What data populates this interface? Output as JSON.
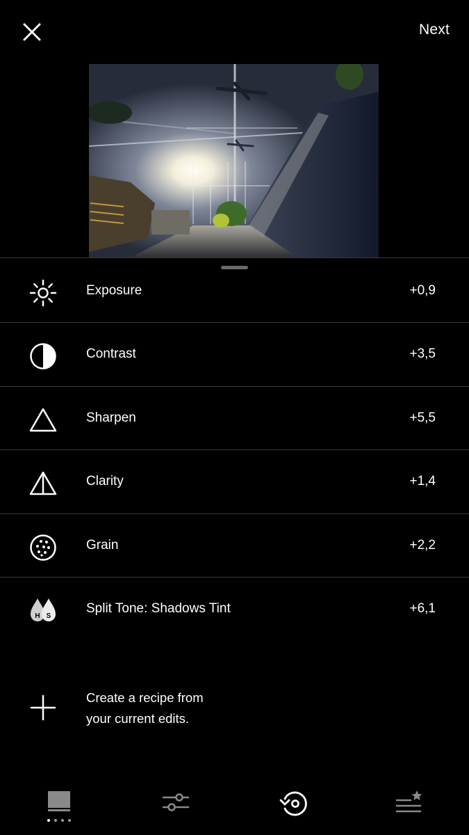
{
  "topbar": {
    "close_icon": "close-icon",
    "next_label": "Next"
  },
  "photo": {
    "alt": "Edited photo preview"
  },
  "edits": [
    {
      "icon": "exposure-sun-icon",
      "label": "Exposure",
      "value": "+0,9"
    },
    {
      "icon": "contrast-icon",
      "label": "Contrast",
      "value": "+3,5"
    },
    {
      "icon": "sharpen-triangle-icon",
      "label": "Sharpen",
      "value": "+5,5"
    },
    {
      "icon": "clarity-split-triangle-icon",
      "label": "Clarity",
      "value": "+1,4"
    },
    {
      "icon": "grain-icon",
      "label": "Grain",
      "value": "+2,2"
    },
    {
      "icon": "split-tone-icon",
      "label": "Split Tone: Shadows Tint",
      "value": "+6,1",
      "icon_letters": [
        "H",
        "S"
      ]
    }
  ],
  "create_recipe": {
    "line1": "Create a recipe from",
    "line2": "your current edits."
  },
  "bottom_nav": [
    {
      "icon": "studio-icon",
      "active": false
    },
    {
      "icon": "adjust-sliders-icon",
      "active": false
    },
    {
      "icon": "history-icon",
      "active": true
    },
    {
      "icon": "recipes-icon",
      "active": false
    }
  ],
  "colors": {
    "background": "#000000",
    "text": "#ffffff",
    "separator": "#3a3a3a",
    "inactive_icon": "#8a8a8a"
  }
}
